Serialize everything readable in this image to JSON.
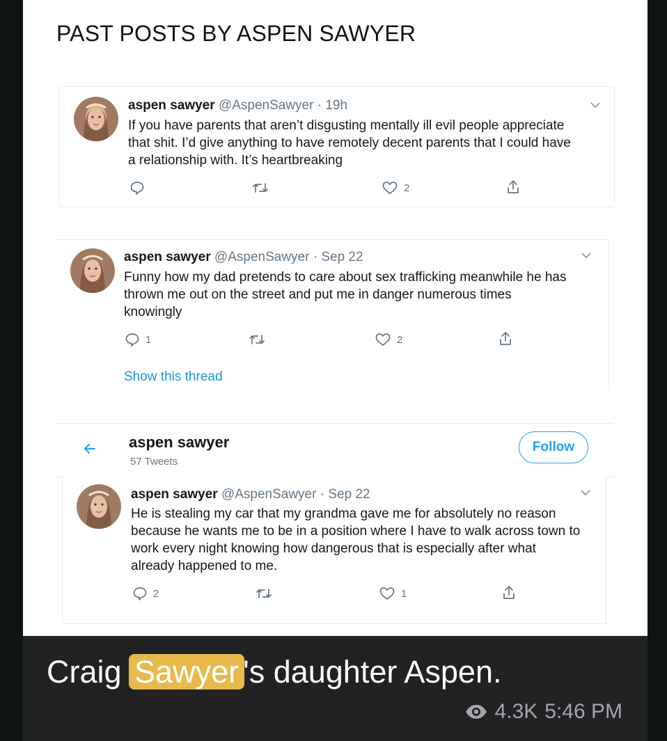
{
  "page_title": "PAST POSTS BY ASPEN SAWYER",
  "tweets": [
    {
      "name": "aspen sawyer",
      "handle": "@AspenSawyer",
      "sep": "·",
      "time": "19h",
      "lines": [
        "If you have parents that aren’t disgusting mentally ill evil people appreciate",
        "that shit. I’d give anything to have remotely decent parents that I could have",
        "a relationship with. It’s heartbreaking"
      ],
      "reply_count": "",
      "like_count": "2"
    },
    {
      "name": "aspen sawyer",
      "handle": "@AspenSawyer",
      "sep": "·",
      "time": "Sep 22",
      "lines": [
        "Funny how my dad pretends to care about sex trafficking meanwhile he has",
        "thrown me out on the street and put me in danger numerous times",
        "knowingly"
      ],
      "reply_count": "1",
      "like_count": "2",
      "thread_link": "Show this thread"
    },
    {
      "name": "aspen sawyer",
      "handle": "@AspenSawyer",
      "sep": "·",
      "time": "Sep 22",
      "lines": [
        "He is stealing my car that my grandma gave me for absolutely no reason",
        "because he wants me to be in a position where I have to walk across town to",
        "work every night knowing how dangerous that is especially after what",
        "already happened to me."
      ],
      "reply_count": "2",
      "like_count": "1"
    }
  ],
  "profile": {
    "name": "aspen sawyer",
    "tweet_count": "57 Tweets",
    "follow_label": "Follow"
  },
  "caption": {
    "before": "Craig ",
    "highlight": "Sawyer",
    "after": "'s daughter Aspen."
  },
  "meta": {
    "views": "4.3K",
    "time": "5:46 PM"
  },
  "colors": {
    "twitter_blue": "#1da1f2",
    "link_blue": "#1b95e0",
    "muted_gray": "#657786",
    "highlight": "#e8b94b",
    "caption_bg": "#222225"
  },
  "icons": [
    "reply-icon",
    "retweet-icon",
    "like-icon",
    "share-icon",
    "chevron-down-icon",
    "back-arrow-icon",
    "eye-icon"
  ]
}
